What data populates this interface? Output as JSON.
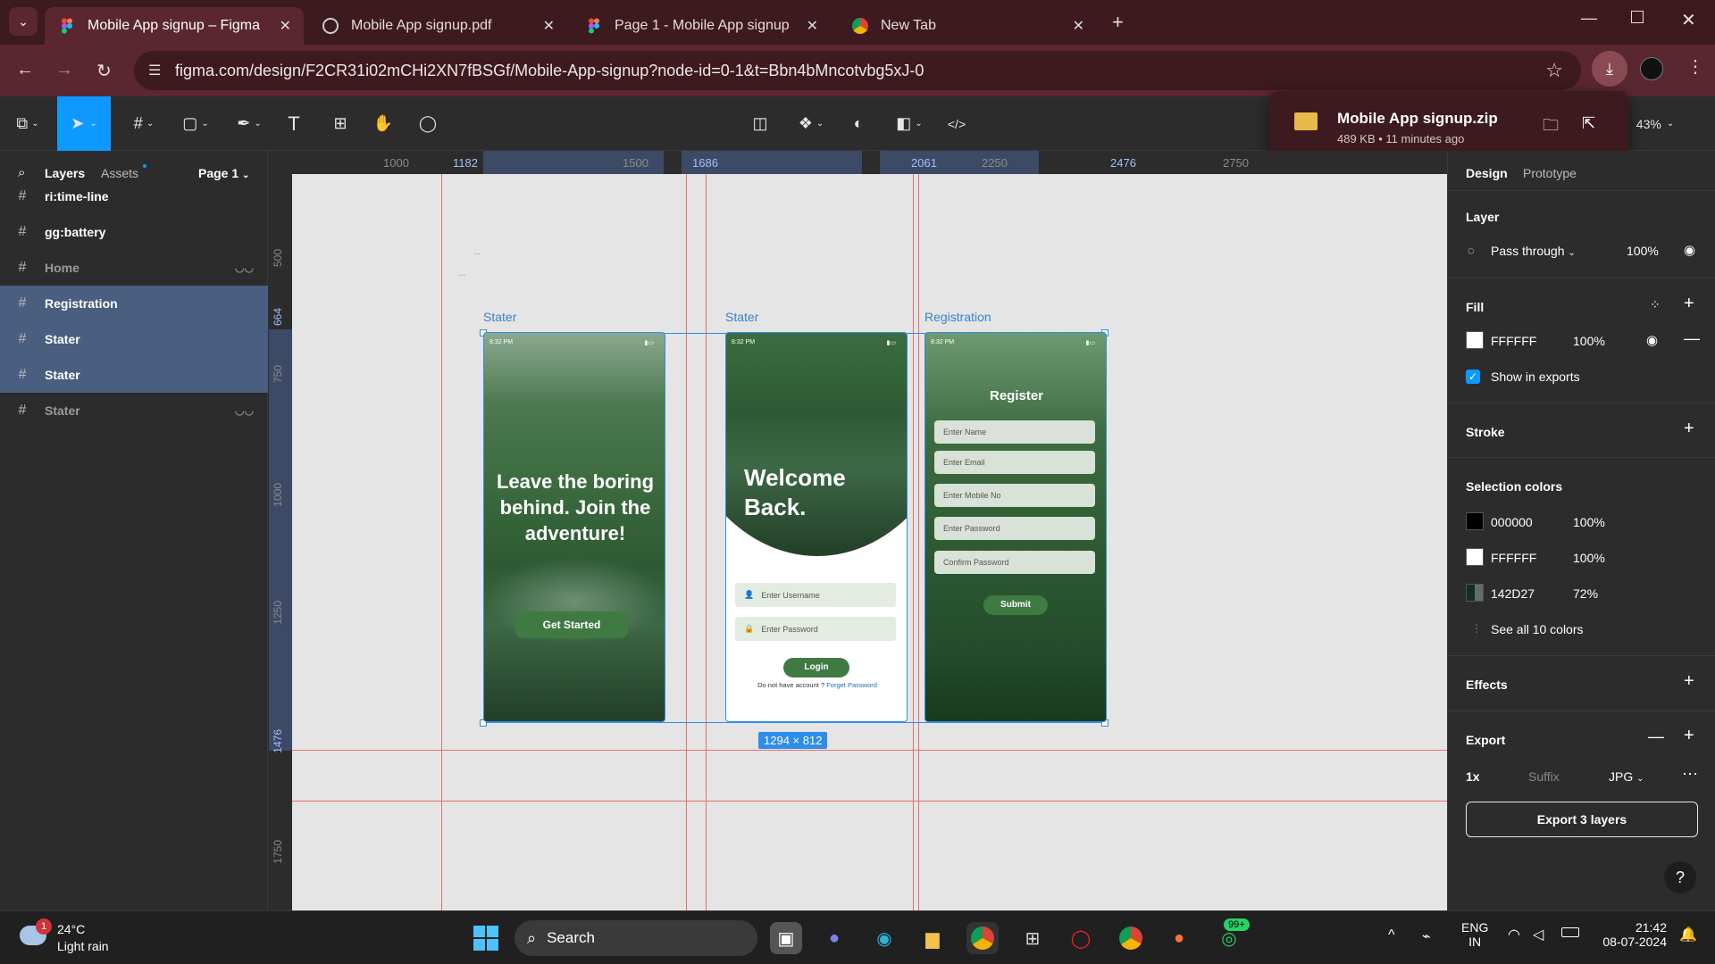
{
  "browser": {
    "tabs": [
      {
        "label": "Mobile App signup – Figma",
        "active": true
      },
      {
        "label": "Mobile App signup.pdf",
        "active": false
      },
      {
        "label": "Page 1 - Mobile App signup",
        "active": false
      },
      {
        "label": "New Tab",
        "active": false
      }
    ],
    "url": "figma.com/design/F2CR31i02mCHi2XN7fBSGf/Mobile-App-signup?node-id=0-1&t=Bbn4bMncotvbg5xJ-0"
  },
  "download": {
    "filename": "Mobile App signup.zip",
    "meta": "489 KB • 11 minutes ago"
  },
  "toolbar": {
    "zoom": "43%"
  },
  "left_panel": {
    "tab_layers": "Layers",
    "tab_assets": "Assets",
    "page": "Page 1",
    "layers": [
      {
        "name": "ri:time-line",
        "selected": false,
        "hidden": false
      },
      {
        "name": "gg:battery",
        "selected": false,
        "hidden": false
      },
      {
        "name": "Home",
        "selected": false,
        "hidden": true
      },
      {
        "name": "Registration",
        "selected": true,
        "hidden": false
      },
      {
        "name": "Stater",
        "selected": true,
        "hidden": false
      },
      {
        "name": "Stater",
        "selected": true,
        "hidden": false
      },
      {
        "name": "Stater",
        "selected": false,
        "hidden": true
      }
    ]
  },
  "rulers": {
    "top": [
      "1000",
      "1182",
      "1500",
      "1686",
      "2061",
      "2250",
      "2476",
      "2750"
    ],
    "left": [
      "500",
      "664",
      "750",
      "1000",
      "1250",
      "1476",
      "1750"
    ]
  },
  "canvas": {
    "frame_labels": [
      "Stater",
      "Stater",
      "Registration"
    ],
    "dots": [
      "...",
      "..."
    ],
    "selection_size": "1294 × 812",
    "screen1": {
      "time": "8:32 PM",
      "headline": "Leave the boring behind. Join the adventure!",
      "button": "Get Started"
    },
    "screen2": {
      "time": "8:32 PM",
      "headline": "Welcome Back.",
      "username_placeholder": "Enter Username",
      "password_placeholder": "Enter Password",
      "login": "Login",
      "no_account": "Do not have account ?",
      "forget": "Forget Password"
    },
    "screen3": {
      "time": "8:32 PM",
      "title": "Register",
      "fields": [
        "Enter Name",
        "Enter Email",
        "Enter Mobile No",
        "Enter Password",
        "Confirm Password"
      ],
      "submit": "Submit"
    }
  },
  "right_panel": {
    "tab_design": "Design",
    "tab_prototype": "Prototype",
    "layer_title": "Layer",
    "blend": "Pass through",
    "layer_opacity": "100%",
    "fill_title": "Fill",
    "fill_hex": "FFFFFF",
    "fill_opacity": "100%",
    "show_exports": "Show in exports",
    "stroke_title": "Stroke",
    "selection_colors_title": "Selection colors",
    "colors": [
      {
        "hex": "000000",
        "opacity": "100%",
        "swatch": "#000000"
      },
      {
        "hex": "FFFFFF",
        "opacity": "100%",
        "swatch": "#FFFFFF"
      },
      {
        "hex": "142D27",
        "opacity": "72%",
        "swatch": "#142D27"
      }
    ],
    "see_all": "See all 10 colors",
    "effects_title": "Effects",
    "export_title": "Export",
    "export_scale": "1x",
    "export_suffix": "Suffix",
    "export_format": "JPG",
    "export_button": "Export 3 layers"
  },
  "taskbar": {
    "weather_temp": "24°C",
    "weather_desc": "Light rain",
    "weather_badge": "1",
    "search": "Search",
    "whatsapp_badge": "99+",
    "lang": "ENG",
    "region": "IN",
    "time": "21:42",
    "date": "08-07-2024"
  }
}
